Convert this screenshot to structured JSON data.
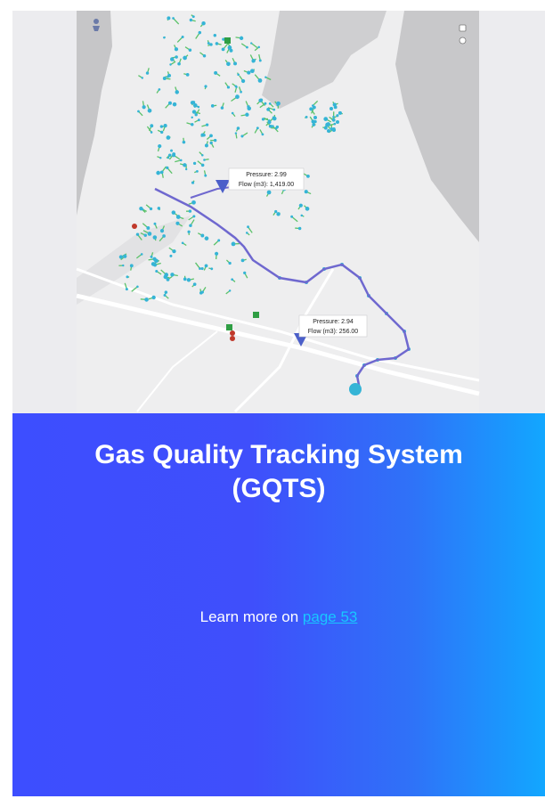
{
  "card": {
    "title": "Gas Quality Tracking System (GQTS)",
    "cta_prefix": "Learn more on ",
    "cta_link": "page 53"
  },
  "map": {
    "callouts": [
      {
        "pressure": "Pressure: 2.99",
        "flow": "Flow (m3): 1,419.00"
      },
      {
        "pressure": "Pressure: 2.94",
        "flow": "Flow (m3): 256.00"
      }
    ]
  },
  "colors": {
    "gradient_start": "#3d4eff",
    "gradient_end": "#12a7ff",
    "link": "#18c8ff",
    "pipeline": "#6f68cf",
    "node": "#35b4d6",
    "segment": "#5cc26a"
  }
}
